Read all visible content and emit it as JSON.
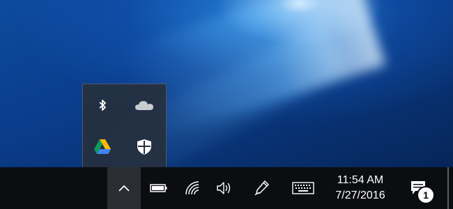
{
  "desktop": {
    "wallpaper": "windows-10-hero"
  },
  "tray_overflow": {
    "items": [
      {
        "name": "bluetooth",
        "icon": "bluetooth-icon"
      },
      {
        "name": "onedrive",
        "icon": "onedrive-cloud-icon"
      },
      {
        "name": "google-drive",
        "icon": "google-drive-icon"
      },
      {
        "name": "windows-defender",
        "icon": "defender-shield-icon"
      }
    ]
  },
  "taskbar": {
    "chevron_icon": "chevron-up-icon",
    "battery_icon": "battery-icon",
    "wifi_icon": "wifi-icon",
    "volume_icon": "volume-icon",
    "pen_icon": "windows-ink-pen-icon",
    "keyboard_icon": "touch-keyboard-icon",
    "clock": {
      "time": "11:54 AM",
      "date": "7/27/2016"
    },
    "action_center": {
      "icon": "action-center-icon",
      "badge": "1"
    }
  },
  "colors": {
    "taskbar": "#0b0d10",
    "flyout": "#26303e",
    "accent": "#0a3f8a"
  }
}
